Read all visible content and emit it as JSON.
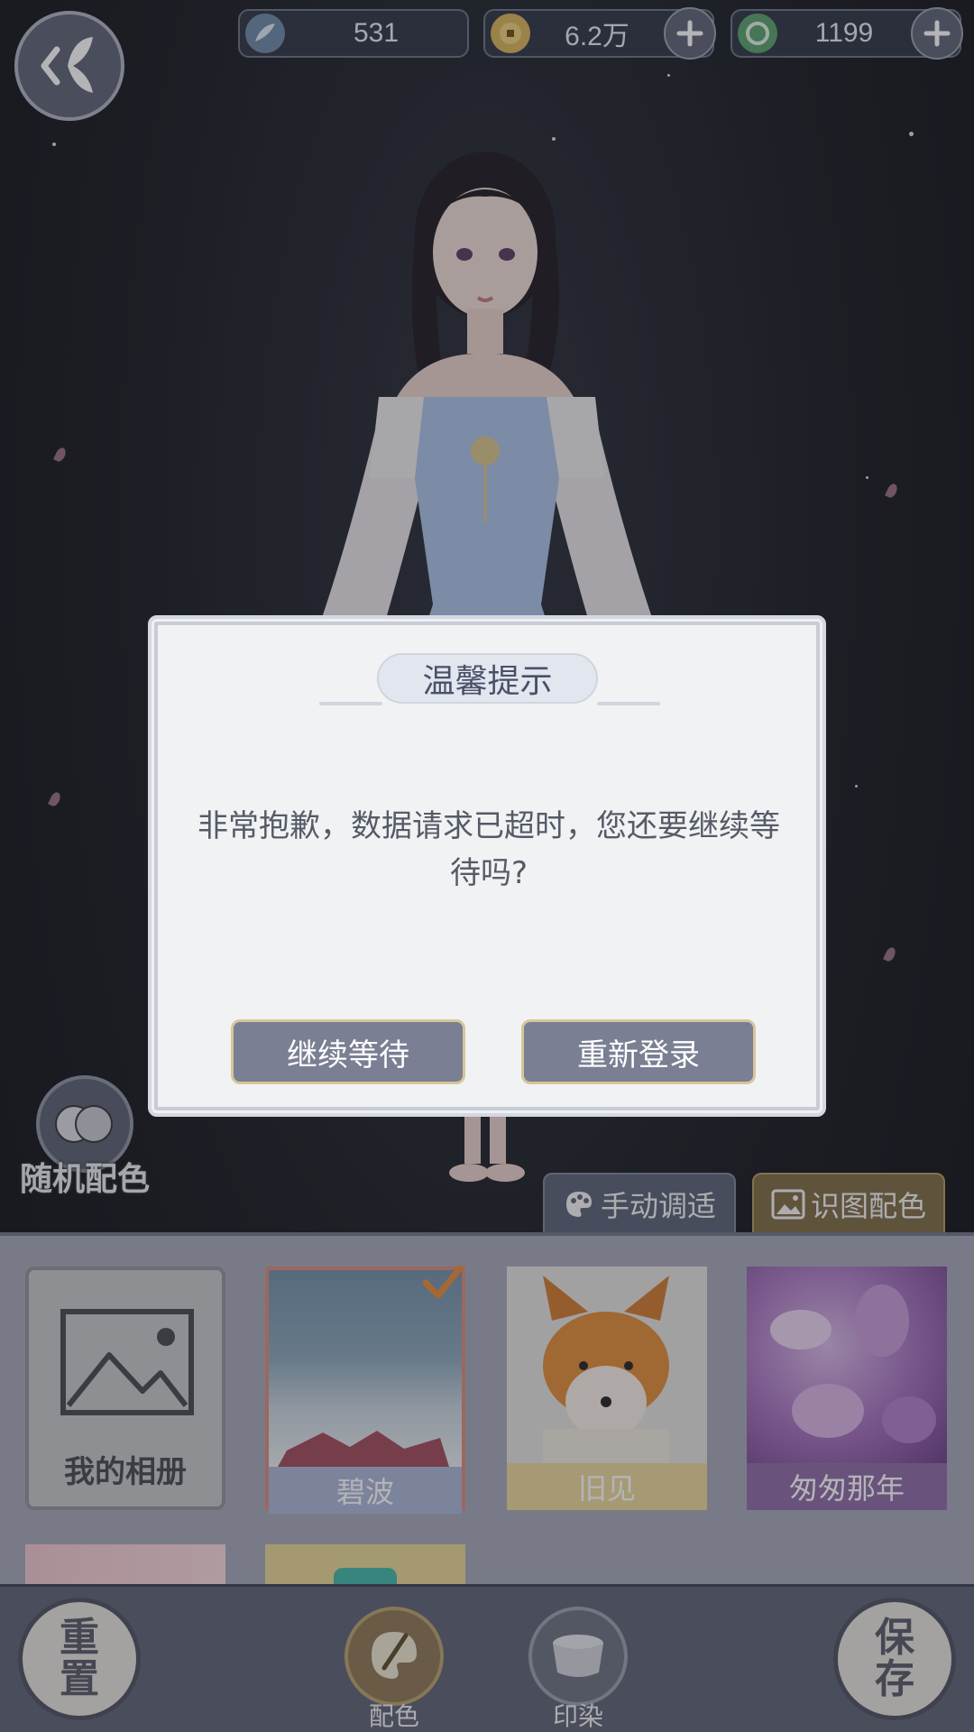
{
  "topbar": {
    "back_icon": "butterfly-back-icon",
    "currencies": [
      {
        "icon": "feather-coin-icon",
        "value": "531",
        "has_plus": false
      },
      {
        "icon": "gold-coin-icon",
        "value": "6.2万",
        "has_plus": true
      },
      {
        "icon": "jade-coin-icon",
        "value": "1199",
        "has_plus": true
      }
    ]
  },
  "dialog": {
    "title": "温馨提示",
    "message": "非常抱歉，数据请求已超时，您还要继续等待吗?",
    "continue_label": "继续等待",
    "relogin_label": "重新登录"
  },
  "random_color": {
    "label": "随机配色"
  },
  "tabs": {
    "manual_label": "手动调适",
    "image_label": "识图配色"
  },
  "gallery": {
    "album_label": "我的相册",
    "presets": [
      {
        "label": "碧波",
        "selected": true
      },
      {
        "label": "旧见",
        "selected": false
      },
      {
        "label": "匆匆那年",
        "selected": false
      }
    ]
  },
  "bottom": {
    "reset_label": "重置",
    "color_label": "配色",
    "dye_label": "印染",
    "save_label": "保存"
  },
  "colors": {
    "accent_gold": "#d6c69a",
    "dialog_bg": "#f1f2f4",
    "button_bg": "#7b7f93",
    "selected_border": "#d98a7a"
  }
}
